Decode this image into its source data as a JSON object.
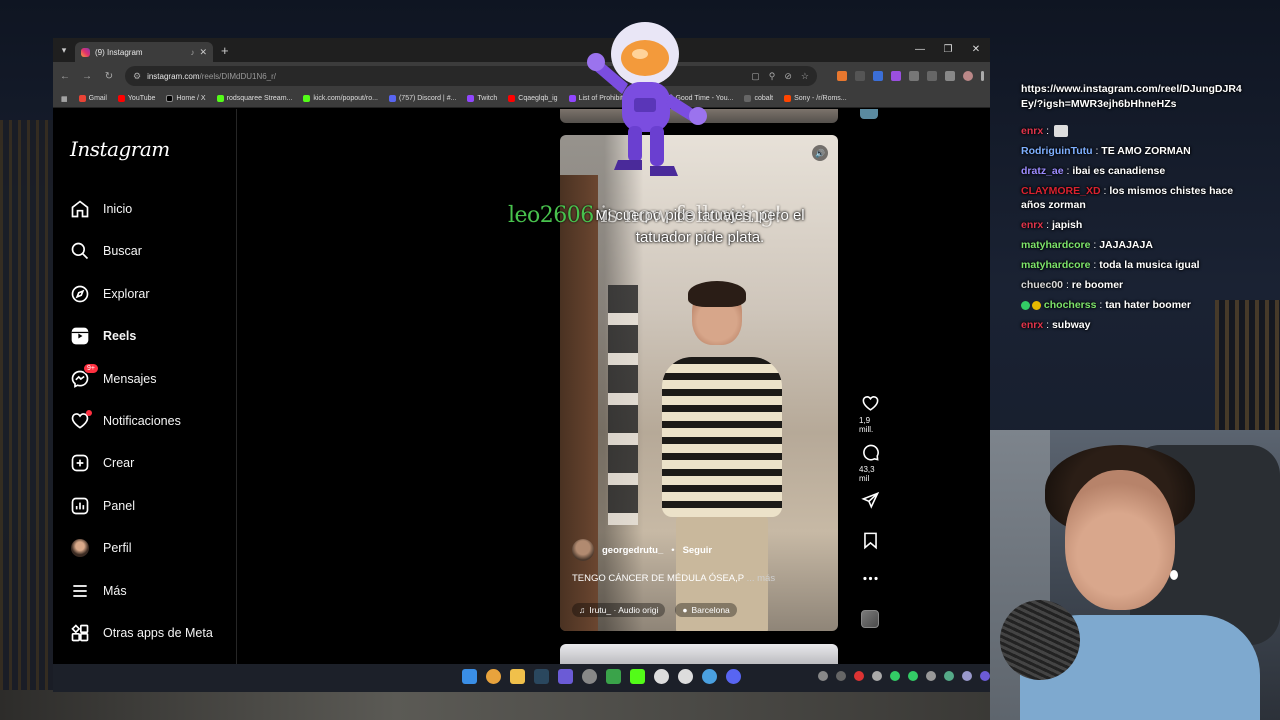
{
  "browser": {
    "tab_title": "(9) Instagram",
    "url_host": "instagram.com",
    "url_path": "/reels/DIMdDU1N6_r/",
    "bookmarks": [
      "Gmail",
      "YouTube",
      "Home / X",
      "rodsquaree Stream...",
      "kick.com/popout/ro...",
      "(757) Discord | #...",
      "Twitch",
      "Cqaeglqb_ig",
      "List of Prohibited G...",
      "(1) Good Time - You...",
      "cobalt",
      "Sony - /r/Roms..."
    ]
  },
  "instagram": {
    "logo": "Instagram",
    "nav": [
      {
        "label": "Inicio",
        "icon": "home-icon"
      },
      {
        "label": "Buscar",
        "icon": "search-icon"
      },
      {
        "label": "Explorar",
        "icon": "compass-icon"
      },
      {
        "label": "Reels",
        "icon": "reels-icon"
      },
      {
        "label": "Mensajes",
        "icon": "messenger-icon",
        "badge": "9+"
      },
      {
        "label": "Notificaciones",
        "icon": "heart-icon"
      },
      {
        "label": "Crear",
        "icon": "plus-square-icon"
      },
      {
        "label": "Panel",
        "icon": "chart-icon"
      },
      {
        "label": "Perfil",
        "icon": "profile-avatar"
      },
      {
        "label": "Más",
        "icon": "menu-icon"
      },
      {
        "label": "Otras apps de Meta",
        "icon": "meta-apps-icon"
      }
    ],
    "reel": {
      "caption": "Mi cuerpo pide tatuajes, pero el tatuador pide plata.",
      "username": "georgedrutu_",
      "separator": "•",
      "follow_label": "Seguir",
      "description": "TENGO CÁNCER DE MÉDULA ÓSEA,P",
      "more_label": "... más",
      "audio": "Irutu_ · Audio origi",
      "location": "Barcelona"
    },
    "actions": {
      "likes": "1,9 mill.",
      "comments": "43,3 mil"
    }
  },
  "overlay": {
    "follower_name": "leo2606",
    "follower_text": " is now following!"
  },
  "chat": {
    "link": "https://www.instagram.com/reel/DJungDJR4Ey/?igsh=MWR3ejh6bHhneHZs",
    "messages": [
      {
        "user": "enrx",
        "color": "#e0344b",
        "msg": ""
      },
      {
        "user": "RodriguinTutu",
        "color": "#7fb0ff",
        "msg": "TE AMO ZORMAN"
      },
      {
        "user": "dratz_ae",
        "color": "#9d8cff",
        "msg": "ibai es canadiense"
      },
      {
        "user": "CLAYMORE_XD",
        "color": "#d9222f",
        "msg": "los mismos chistes hace años zorman"
      },
      {
        "user": "enrx",
        "color": "#e0344b",
        "msg": "japish"
      },
      {
        "user": "matyhardcore",
        "color": "#7de36b",
        "msg": "JAJAJAJA"
      },
      {
        "user": "matyhardcore",
        "color": "#7de36b",
        "msg": "toda la musica igual"
      },
      {
        "user": "chuec00",
        "color": "#d8d8d8",
        "msg": "re boomer"
      },
      {
        "user": "chocherss",
        "color": "#7de36b",
        "msg": "tan hater boomer"
      },
      {
        "user": "enrx",
        "color": "#e0344b",
        "msg": "subway"
      }
    ]
  }
}
